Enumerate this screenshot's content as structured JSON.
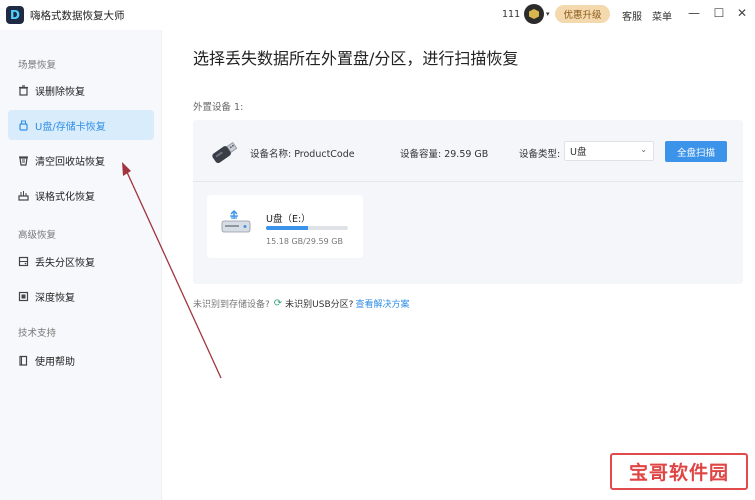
{
  "titlebar": {
    "logo_letter": "D",
    "app_title": "嗨格式数据恢复大师",
    "user_id": "111",
    "upgrade_label": "优惠升级",
    "service_label": "客服",
    "menu_label": "菜单",
    "minimize": "—",
    "maximize": "☐",
    "close": "✕"
  },
  "sidebar": {
    "sections": [
      {
        "title": "场景恢复"
      },
      {
        "title": "高级恢复"
      },
      {
        "title": "技术支持"
      }
    ],
    "items": [
      {
        "label": "误删除恢复",
        "icon": "trash-restore-icon"
      },
      {
        "label": "U盘/存储卡恢复",
        "icon": "usb-card-icon",
        "active": true
      },
      {
        "label": "清空回收站恢复",
        "icon": "recycle-bin-icon"
      },
      {
        "label": "误格式化恢复",
        "icon": "format-icon"
      },
      {
        "label": "丢失分区恢复",
        "icon": "partition-icon"
      },
      {
        "label": "深度恢复",
        "icon": "deep-scan-icon"
      },
      {
        "label": "使用帮助",
        "icon": "help-book-icon"
      }
    ]
  },
  "main": {
    "title": "选择丢失数据所在外置盘/分区，进行扫描恢复",
    "external_device_label": "外置设备 1:",
    "device": {
      "name_label": "设备名称: ProductCode",
      "capacity_label": "设备容量: 29.59 GB",
      "type_label": "设备类型:",
      "type_value": "U盘",
      "scan_button": "全盘扫描"
    },
    "partition": {
      "name": "U盘（E:）",
      "usage_text": "15.18 GB/29.59 GB",
      "usage_fraction": 0.513
    },
    "hint": {
      "question": "未识别到存储设备?",
      "plain": "未识别USB分区?",
      "link": "查看解决方案"
    }
  },
  "colors": {
    "accent": "#3b93ea",
    "active_bg": "#d9ecfb",
    "annotation_arrow": "#a2343f",
    "watermark_red": "#e04545"
  },
  "watermark": {
    "text": "宝哥软件园"
  }
}
